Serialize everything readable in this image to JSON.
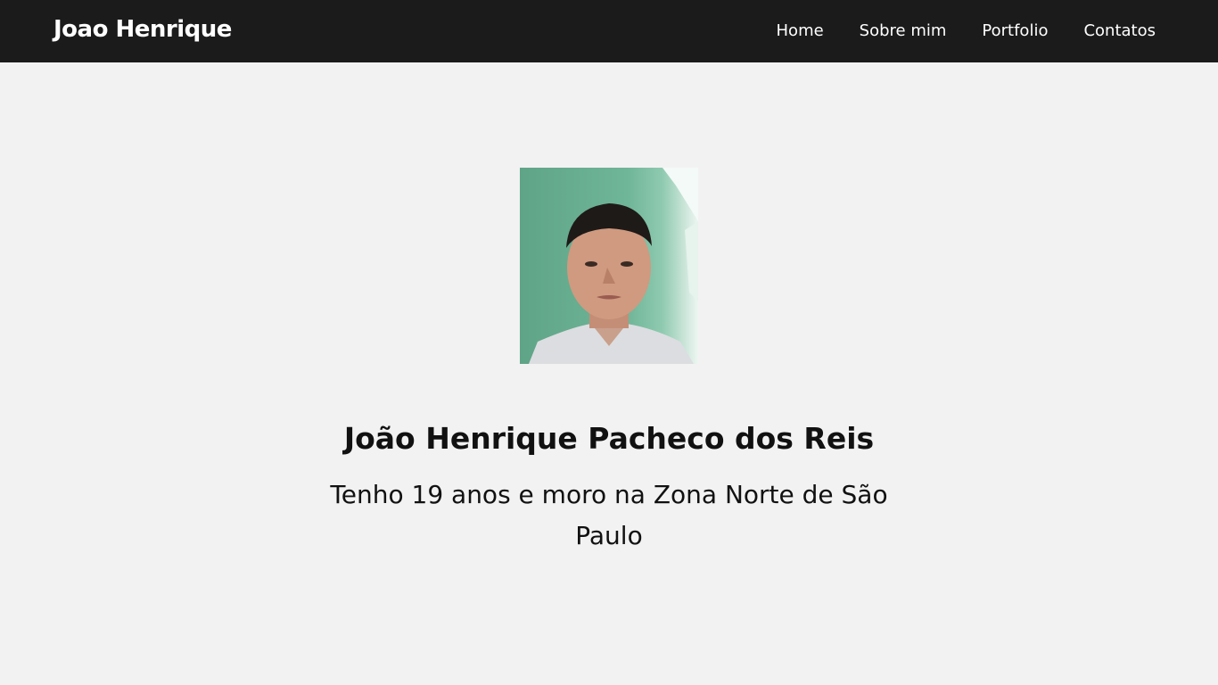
{
  "navbar": {
    "brand": "Joao Henrique",
    "links": [
      "Home",
      "Sobre mim",
      "Portfolio",
      "Contatos"
    ]
  },
  "profile": {
    "name": "João Henrique Pacheco dos Reis",
    "bio": "Tenho 19 anos e moro na Zona Norte de São Paulo"
  },
  "colors": {
    "navbar_bg": "#1b1b1b",
    "page_bg": "#f2f2f2",
    "text": "#111111"
  }
}
